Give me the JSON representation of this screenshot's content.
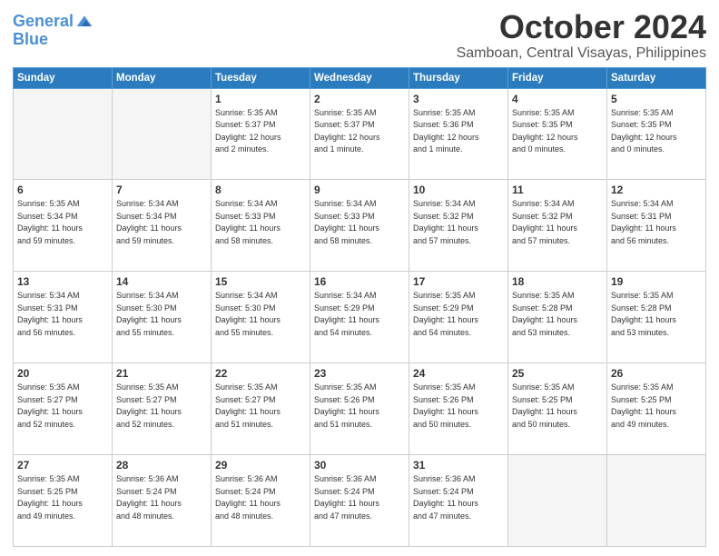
{
  "logo": {
    "line1": "General",
    "line2": "Blue"
  },
  "title": {
    "month": "October 2024",
    "location": "Samboan, Central Visayas, Philippines"
  },
  "headers": [
    "Sunday",
    "Monday",
    "Tuesday",
    "Wednesday",
    "Thursday",
    "Friday",
    "Saturday"
  ],
  "weeks": [
    [
      {
        "day": "",
        "info": ""
      },
      {
        "day": "",
        "info": ""
      },
      {
        "day": "1",
        "info": "Sunrise: 5:35 AM\nSunset: 5:37 PM\nDaylight: 12 hours\nand 2 minutes."
      },
      {
        "day": "2",
        "info": "Sunrise: 5:35 AM\nSunset: 5:37 PM\nDaylight: 12 hours\nand 1 minute."
      },
      {
        "day": "3",
        "info": "Sunrise: 5:35 AM\nSunset: 5:36 PM\nDaylight: 12 hours\nand 1 minute."
      },
      {
        "day": "4",
        "info": "Sunrise: 5:35 AM\nSunset: 5:35 PM\nDaylight: 12 hours\nand 0 minutes."
      },
      {
        "day": "5",
        "info": "Sunrise: 5:35 AM\nSunset: 5:35 PM\nDaylight: 12 hours\nand 0 minutes."
      }
    ],
    [
      {
        "day": "6",
        "info": "Sunrise: 5:35 AM\nSunset: 5:34 PM\nDaylight: 11 hours\nand 59 minutes."
      },
      {
        "day": "7",
        "info": "Sunrise: 5:34 AM\nSunset: 5:34 PM\nDaylight: 11 hours\nand 59 minutes."
      },
      {
        "day": "8",
        "info": "Sunrise: 5:34 AM\nSunset: 5:33 PM\nDaylight: 11 hours\nand 58 minutes."
      },
      {
        "day": "9",
        "info": "Sunrise: 5:34 AM\nSunset: 5:33 PM\nDaylight: 11 hours\nand 58 minutes."
      },
      {
        "day": "10",
        "info": "Sunrise: 5:34 AM\nSunset: 5:32 PM\nDaylight: 11 hours\nand 57 minutes."
      },
      {
        "day": "11",
        "info": "Sunrise: 5:34 AM\nSunset: 5:32 PM\nDaylight: 11 hours\nand 57 minutes."
      },
      {
        "day": "12",
        "info": "Sunrise: 5:34 AM\nSunset: 5:31 PM\nDaylight: 11 hours\nand 56 minutes."
      }
    ],
    [
      {
        "day": "13",
        "info": "Sunrise: 5:34 AM\nSunset: 5:31 PM\nDaylight: 11 hours\nand 56 minutes."
      },
      {
        "day": "14",
        "info": "Sunrise: 5:34 AM\nSunset: 5:30 PM\nDaylight: 11 hours\nand 55 minutes."
      },
      {
        "day": "15",
        "info": "Sunrise: 5:34 AM\nSunset: 5:30 PM\nDaylight: 11 hours\nand 55 minutes."
      },
      {
        "day": "16",
        "info": "Sunrise: 5:34 AM\nSunset: 5:29 PM\nDaylight: 11 hours\nand 54 minutes."
      },
      {
        "day": "17",
        "info": "Sunrise: 5:35 AM\nSunset: 5:29 PM\nDaylight: 11 hours\nand 54 minutes."
      },
      {
        "day": "18",
        "info": "Sunrise: 5:35 AM\nSunset: 5:28 PM\nDaylight: 11 hours\nand 53 minutes."
      },
      {
        "day": "19",
        "info": "Sunrise: 5:35 AM\nSunset: 5:28 PM\nDaylight: 11 hours\nand 53 minutes."
      }
    ],
    [
      {
        "day": "20",
        "info": "Sunrise: 5:35 AM\nSunset: 5:27 PM\nDaylight: 11 hours\nand 52 minutes."
      },
      {
        "day": "21",
        "info": "Sunrise: 5:35 AM\nSunset: 5:27 PM\nDaylight: 11 hours\nand 52 minutes."
      },
      {
        "day": "22",
        "info": "Sunrise: 5:35 AM\nSunset: 5:27 PM\nDaylight: 11 hours\nand 51 minutes."
      },
      {
        "day": "23",
        "info": "Sunrise: 5:35 AM\nSunset: 5:26 PM\nDaylight: 11 hours\nand 51 minutes."
      },
      {
        "day": "24",
        "info": "Sunrise: 5:35 AM\nSunset: 5:26 PM\nDaylight: 11 hours\nand 50 minutes."
      },
      {
        "day": "25",
        "info": "Sunrise: 5:35 AM\nSunset: 5:25 PM\nDaylight: 11 hours\nand 50 minutes."
      },
      {
        "day": "26",
        "info": "Sunrise: 5:35 AM\nSunset: 5:25 PM\nDaylight: 11 hours\nand 49 minutes."
      }
    ],
    [
      {
        "day": "27",
        "info": "Sunrise: 5:35 AM\nSunset: 5:25 PM\nDaylight: 11 hours\nand 49 minutes."
      },
      {
        "day": "28",
        "info": "Sunrise: 5:36 AM\nSunset: 5:24 PM\nDaylight: 11 hours\nand 48 minutes."
      },
      {
        "day": "29",
        "info": "Sunrise: 5:36 AM\nSunset: 5:24 PM\nDaylight: 11 hours\nand 48 minutes."
      },
      {
        "day": "30",
        "info": "Sunrise: 5:36 AM\nSunset: 5:24 PM\nDaylight: 11 hours\nand 47 minutes."
      },
      {
        "day": "31",
        "info": "Sunrise: 5:36 AM\nSunset: 5:24 PM\nDaylight: 11 hours\nand 47 minutes."
      },
      {
        "day": "",
        "info": ""
      },
      {
        "day": "",
        "info": ""
      }
    ]
  ]
}
